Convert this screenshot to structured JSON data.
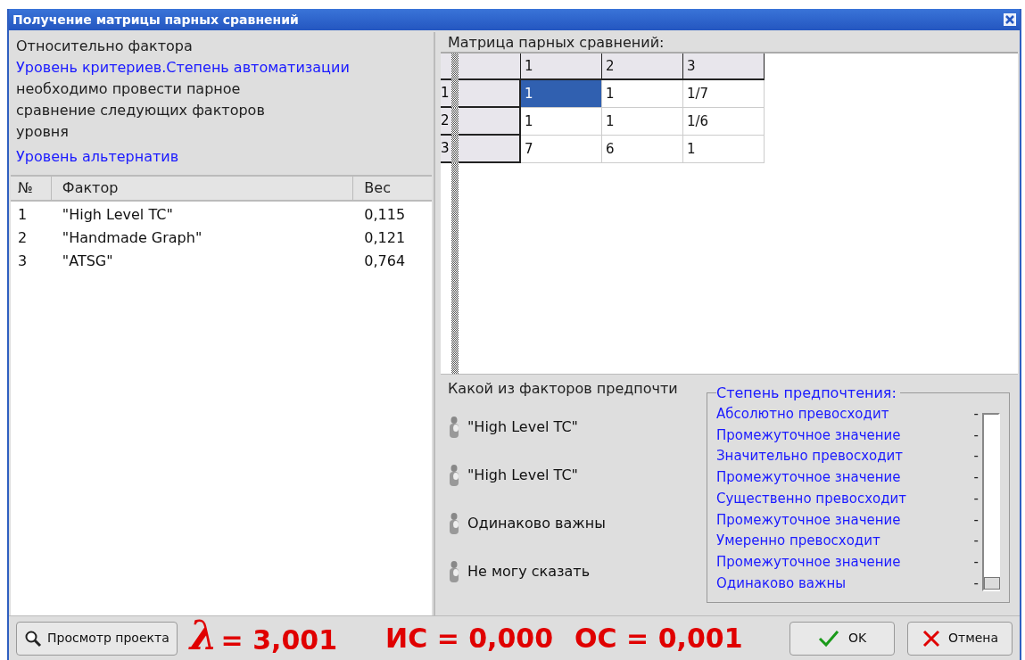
{
  "window": {
    "title": "Получение матрицы парных сравнений"
  },
  "criterion": {
    "prefix": "Относительно фактора",
    "factor": "Уровень критериев.Степень автоматизации",
    "instruction": "необходимо провести парное сравнение следующих факторов уровня",
    "level": "Уровень альтернатив"
  },
  "factors_table": {
    "columns": [
      "№",
      "Фактор",
      "Вес"
    ],
    "rows": [
      [
        "1",
        "\"High Level TC\"",
        "0,115"
      ],
      [
        "2",
        "\"Handmade Graph\"",
        "0,121"
      ],
      [
        "3",
        "\"ATSG\"",
        "0,764"
      ]
    ]
  },
  "matrix": {
    "title": "Матрица парных сравнений:",
    "columns": [
      "1",
      "2",
      "3"
    ],
    "rows": [
      {
        "header": "1",
        "cells": [
          {
            "value": "1",
            "selected": true
          },
          {
            "value": "1",
            "selected": false
          },
          {
            "value": "1/7",
            "selected": false
          }
        ]
      },
      {
        "header": "2",
        "cells": [
          {
            "value": "1",
            "selected": false
          },
          {
            "value": "1",
            "selected": false
          },
          {
            "value": "1/6",
            "selected": false
          }
        ]
      },
      {
        "header": "3",
        "cells": [
          {
            "value": "7",
            "selected": false
          },
          {
            "value": "6",
            "selected": false
          },
          {
            "value": "1",
            "selected": false
          }
        ]
      }
    ]
  },
  "question": {
    "text": "Какой из факторов предпочти",
    "options": [
      {
        "label": "\"High Level TC\"",
        "selected": false
      },
      {
        "label": "\"High Level TC\"",
        "selected": false
      },
      {
        "label": "Одинаково важны",
        "selected": false
      },
      {
        "label": "Не могу сказать",
        "selected": false
      }
    ]
  },
  "preference": {
    "title": "Степень предпочтения:",
    "scale": [
      "Абсолютно превосходит",
      "Промежуточное значение",
      "Значительно превосходит",
      "Промежуточное значение",
      "Существенно превосходит",
      "Промежуточное значение",
      "Умеренно превосходит",
      "Промежуточное значение",
      "Одинаково важны"
    ],
    "tick": "-",
    "level": 0
  },
  "footer": {
    "view_button": "Просмотр проекта",
    "lambda_symbol": "λ",
    "lambda_value": "= 3,001",
    "ci": "ИС = 0,000",
    "cr": "ОС = 0,001",
    "ok": "OK",
    "cancel": "Отмена"
  }
}
